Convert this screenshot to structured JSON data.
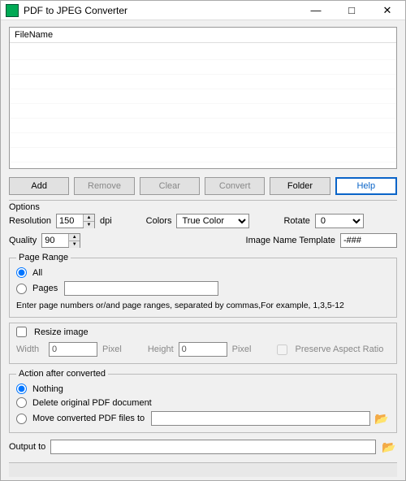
{
  "window": {
    "title": "PDF to JPEG Converter"
  },
  "fileList": {
    "header": "FileName"
  },
  "buttons": {
    "add": "Add",
    "remove": "Remove",
    "clear": "Clear",
    "convert": "Convert",
    "folder": "Folder",
    "help": "Help"
  },
  "options": {
    "title": "Options",
    "resolutionLabel": "Resolution",
    "resolutionValue": "150",
    "dpi": "dpi",
    "colorsLabel": "Colors",
    "colorsValue": "True Color",
    "rotateLabel": "Rotate",
    "rotateValue": "0",
    "qualityLabel": "Quality",
    "qualityValue": "90",
    "templateLabel": "Image Name Template",
    "templateValue": "-###"
  },
  "pageRange": {
    "legend": "Page Range",
    "all": "All",
    "pages": "Pages",
    "pagesValue": "",
    "hint": "Enter page numbers or/and page ranges, separated by commas,For example, 1,3,5-12"
  },
  "resize": {
    "label": "Resize image",
    "widthLabel": "Width",
    "widthValue": "0",
    "heightLabel": "Height",
    "heightValue": "0",
    "pixel": "Pixel",
    "preserve": "Preserve Aspect Ratio"
  },
  "action": {
    "legend": "Action after converted",
    "nothing": "Nothing",
    "delete": "Delete original PDF document",
    "move": "Move converted PDF files to",
    "movePath": ""
  },
  "output": {
    "label": "Output to",
    "value": ""
  }
}
